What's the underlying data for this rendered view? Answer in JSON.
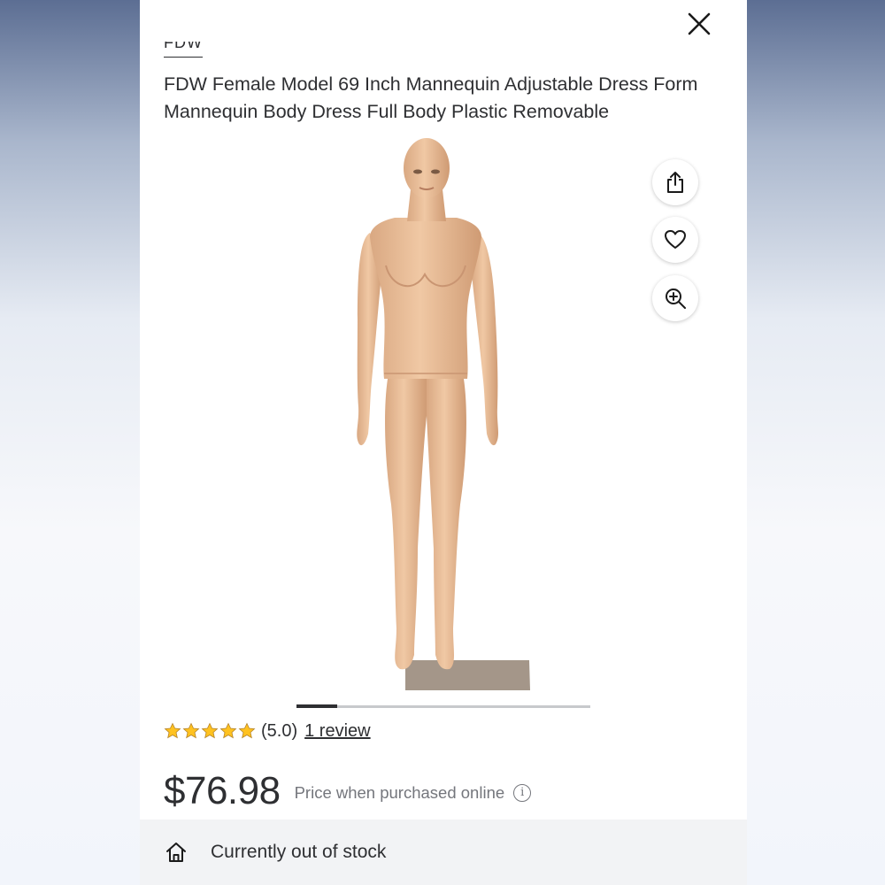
{
  "brand": {
    "label": "FDW"
  },
  "product": {
    "title": "FDW Female Model 69 Inch Mannequin Adjustable Dress Form Mannequin Body Dress Full Body Plastic Removable",
    "image_icon": "mannequin-product-image"
  },
  "actions": [
    {
      "icon": "share-icon"
    },
    {
      "icon": "heart-icon"
    },
    {
      "icon": "zoom-in-icon"
    }
  ],
  "carousel": {
    "current_index": 1,
    "progress_fraction": 0.14
  },
  "rating": {
    "stars": 5,
    "value_text": "(5.0)",
    "reviews_text": "1 review",
    "star_color": "#ffc220"
  },
  "price": {
    "amount": "$76.98",
    "note": "Price when purchased online",
    "info_icon": "info-icon"
  },
  "availability": {
    "icon": "home-icon",
    "status": "Currently out of stock"
  },
  "colors": {
    "text": "#2e2f32",
    "muted": "#74767c",
    "stock_bar_bg": "#f2f3f5"
  }
}
